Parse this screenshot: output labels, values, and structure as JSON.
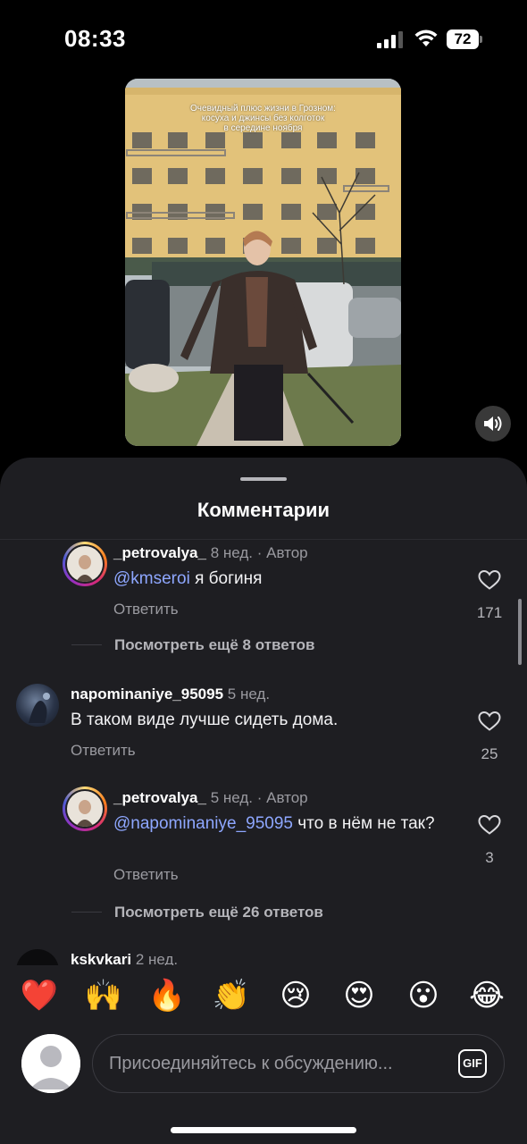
{
  "status": {
    "time": "08:33",
    "battery": "72"
  },
  "video": {
    "caption_lines": [
      "Очевидный плюс жизни в Грозном:",
      "косуха и джинсы без колготок",
      "в середине ноября"
    ]
  },
  "sheet": {
    "title": "Комментарии"
  },
  "comments": [
    {
      "username": "_petrovalya_",
      "time": "8 нед.",
      "author_badge": "· Автор",
      "mention": "@kmseroi",
      "text": " я богиня",
      "reply": "Ответить",
      "likes": "171",
      "more_replies": "Посмотреть ещё 8 ответов"
    },
    {
      "username": "napominaniye_95095",
      "time": "5 нед.",
      "text": "В таком виде лучше сидеть дома.",
      "reply": "Ответить",
      "likes": "25"
    },
    {
      "username": "_petrovalya_",
      "time": "5 нед.",
      "author_badge": "· Автор",
      "mention": "@napominaniye_95095",
      "text": " что в нём не так?",
      "reply": "Ответить",
      "likes": "3",
      "more_replies": "Посмотреть ещё 26 ответов"
    },
    {
      "username": "kskvkari",
      "time": "2 нед."
    }
  ],
  "emoji_bar": [
    "❤️",
    "🙌",
    "🔥",
    "👏",
    "😢",
    "😍",
    "😮",
    "😂"
  ],
  "input": {
    "placeholder": "Присоединяйтесь к обсуждению...",
    "gif_label": "GIF"
  },
  "colors": {
    "sheet_bg": "#1e1e22",
    "mention": "#8ea7ff",
    "muted": "#9a9aa0"
  }
}
